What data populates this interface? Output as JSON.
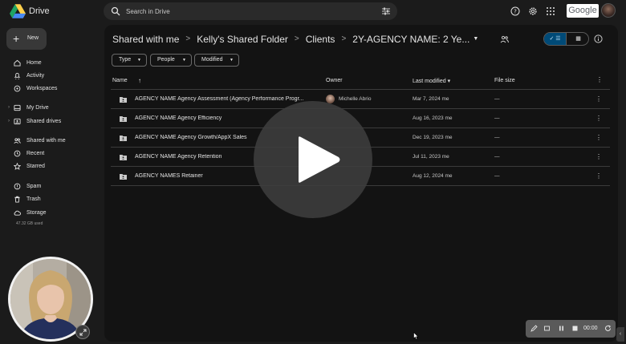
{
  "app": {
    "name": "Drive",
    "brand_colors": [
      "#1fa463",
      "#ffd04b",
      "#4688f4"
    ]
  },
  "search": {
    "placeholder": "Search in Drive"
  },
  "header": {
    "google_label": "Google"
  },
  "sidebar": {
    "new_label": "New",
    "items": [
      {
        "label": "Home",
        "icon": "home-icon"
      },
      {
        "label": "Activity",
        "icon": "activity-icon"
      },
      {
        "label": "Workspaces",
        "icon": "workspaces-icon"
      },
      {
        "label": "My Drive",
        "icon": "my-drive-icon"
      },
      {
        "label": "Shared drives",
        "icon": "shared-drives-icon"
      },
      {
        "label": "Shared with me",
        "icon": "people-icon"
      },
      {
        "label": "Recent",
        "icon": "clock-icon"
      },
      {
        "label": "Starred",
        "icon": "star-icon"
      },
      {
        "label": "Spam",
        "icon": "spam-icon"
      },
      {
        "label": "Trash",
        "icon": "trash-icon"
      },
      {
        "label": "Storage",
        "icon": "cloud-icon"
      }
    ],
    "storage_used": "47.32 GB used"
  },
  "breadcrumb": {
    "items": [
      "Shared with me",
      "Kelly's Shared Folder",
      "Clients",
      "2Y-AGENCY NAME: 2 Ye..."
    ]
  },
  "filters": {
    "type": "Type",
    "people": "People",
    "modified": "Modified"
  },
  "table": {
    "headers": {
      "name": "Name",
      "owner": "Owner",
      "modified": "Last modified",
      "size": "File size"
    },
    "rows": [
      {
        "name": "AGENCY NAME Agency Assessment (Agency Performance Progr...",
        "owner": "Michelle Abrio",
        "modified": "Mar 7, 2024 me",
        "size": "—"
      },
      {
        "name": "AGENCY NAME Agency Efficiency",
        "owner": "",
        "modified": "Aug 16, 2023 me",
        "size": "—"
      },
      {
        "name": "AGENCY NAME Agency Growth/AppX Sales",
        "owner": "",
        "modified": "Dec 19, 2023 me",
        "size": "—"
      },
      {
        "name": "AGENCY NAME Agency Retention",
        "owner": "",
        "modified": "Jul 11, 2023 me",
        "size": "—"
      },
      {
        "name": "AGENCY NAMES Retainer",
        "owner": "",
        "modified": "Aug 12, 2024 me",
        "size": "—"
      }
    ]
  },
  "recorder": {
    "timer": "00:00"
  }
}
